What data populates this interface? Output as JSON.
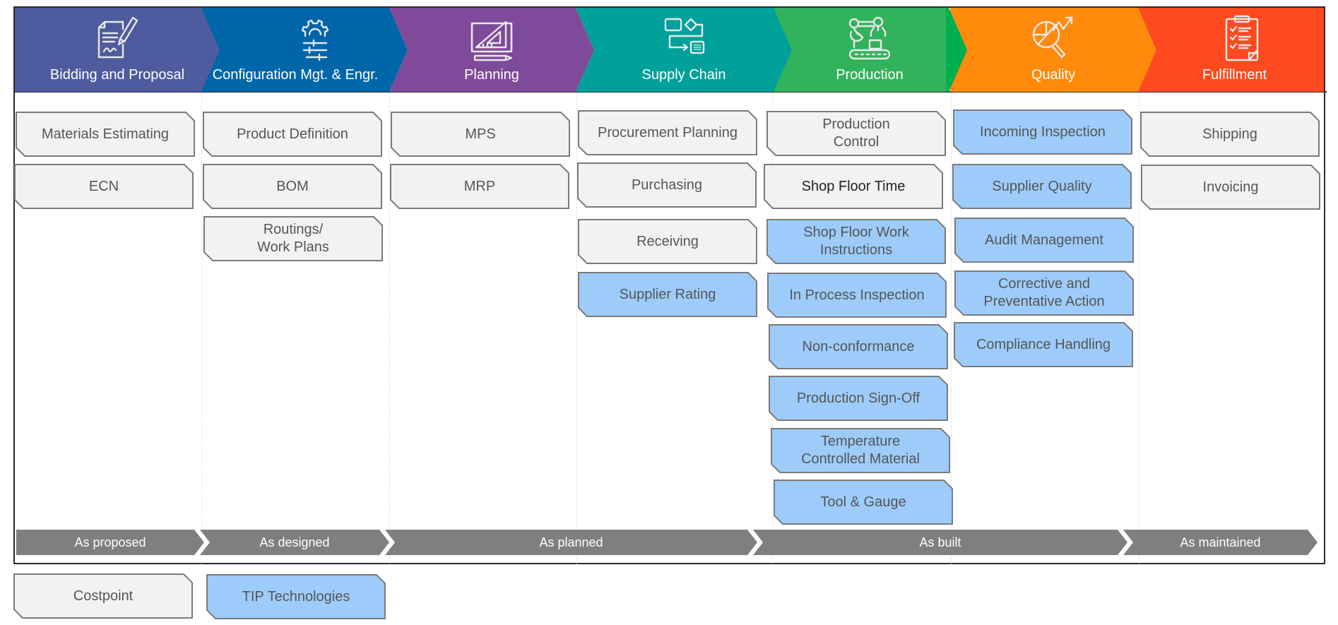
{
  "colors": {
    "stage_bidding": "#4E5B9E",
    "stage_config": "#0066AA",
    "stage_planning": "#7F4A9A",
    "stage_supply": "#00A19A",
    "stage_production": "#33B25C",
    "stage_production_tip": "#00B04F",
    "stage_quality": "#FF8A0C",
    "stage_fulfillment": "#FF4A1F",
    "box_costpoint_fill": "#F2F2F2",
    "box_tip_fill": "#9DCCFA",
    "box_border": "#7A7A7A",
    "lifecycle_fill": "#7F7F7F"
  },
  "stages": [
    {
      "label": "Bidding and Proposal",
      "icon": "contract-signature-icon"
    },
    {
      "label": "Configuration Mgt. & Engr.",
      "icon": "gear-sliders-icon"
    },
    {
      "label": "Planning",
      "icon": "blueprint-ruler-icon"
    },
    {
      "label": "Supply Chain",
      "icon": "flow-process-icon"
    },
    {
      "label": "Production",
      "icon": "robot-arm-conveyor-icon"
    },
    {
      "label": "Quality",
      "icon": "chart-magnifier-icon"
    },
    {
      "label": "Fulfillment",
      "icon": "clipboard-checklist-icon"
    }
  ],
  "columns": [
    {
      "stage": "Bidding and Proposal",
      "items": [
        {
          "label": "Materials Estimating",
          "system": "Costpoint"
        },
        {
          "label": "ECN",
          "system": "Costpoint"
        }
      ]
    },
    {
      "stage": "Configuration Mgt. & Engr.",
      "items": [
        {
          "label": "Product Definition",
          "system": "Costpoint"
        },
        {
          "label": "BOM",
          "system": "Costpoint"
        },
        {
          "label": "Routings/\nWork Plans",
          "system": "Costpoint"
        }
      ]
    },
    {
      "stage": "Planning",
      "items": [
        {
          "label": "MPS",
          "system": "Costpoint"
        },
        {
          "label": "MRP",
          "system": "Costpoint"
        }
      ]
    },
    {
      "stage": "Supply Chain",
      "items": [
        {
          "label": "Procurement Planning",
          "system": "Costpoint"
        },
        {
          "label": "Purchasing",
          "system": "Costpoint"
        },
        {
          "label": "Receiving",
          "system": "Costpoint"
        },
        {
          "label": "Supplier Rating",
          "system": "TIP Technologies"
        }
      ]
    },
    {
      "stage": "Production",
      "items": [
        {
          "label": "Production\nControl",
          "system": "Costpoint"
        },
        {
          "label": "Shop Floor Time",
          "system": "Costpoint"
        },
        {
          "label": "Shop Floor Work\nInstructions",
          "system": "TIP Technologies"
        },
        {
          "label": "In Process Inspection",
          "system": "TIP Technologies"
        },
        {
          "label": "Non-conformance",
          "system": "TIP Technologies"
        },
        {
          "label": "Production Sign-Off",
          "system": "TIP Technologies"
        },
        {
          "label": "Temperature\nControlled Material",
          "system": "TIP Technologies"
        },
        {
          "label": "Tool & Gauge",
          "system": "TIP Technologies"
        }
      ]
    },
    {
      "stage": "Quality",
      "items": [
        {
          "label": "Incoming Inspection",
          "system": "TIP Technologies"
        },
        {
          "label": "Supplier Quality",
          "system": "TIP Technologies"
        },
        {
          "label": "Audit Management",
          "system": "TIP Technologies"
        },
        {
          "label": "Corrective and\nPreventative Action",
          "system": "TIP Technologies"
        },
        {
          "label": "Compliance Handling",
          "system": "TIP Technologies"
        }
      ]
    },
    {
      "stage": "Fulfillment",
      "items": [
        {
          "label": "Shipping",
          "system": "Costpoint"
        },
        {
          "label": "Invoicing",
          "system": "Costpoint"
        }
      ]
    }
  ],
  "lifecycle": [
    {
      "label": "As proposed"
    },
    {
      "label": "As designed"
    },
    {
      "label": "As planned"
    },
    {
      "label": "As built"
    },
    {
      "label": "As maintained"
    }
  ],
  "legend": [
    {
      "label": "Costpoint"
    },
    {
      "label": "TIP Technologies"
    }
  ]
}
